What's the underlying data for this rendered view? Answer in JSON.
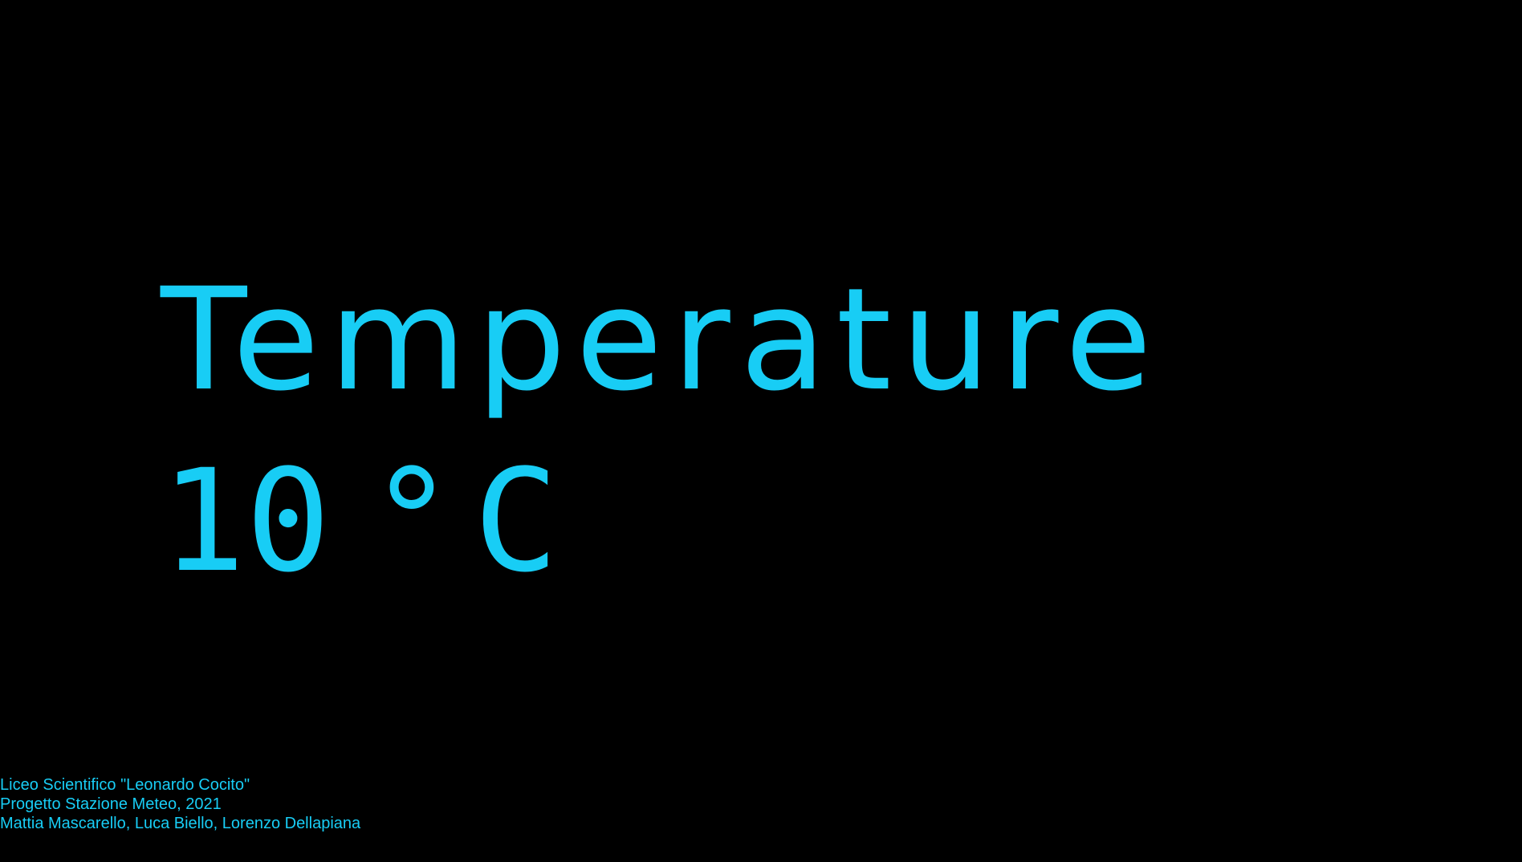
{
  "measurement": {
    "label": "Temperature",
    "value": "10",
    "unit": "°C"
  },
  "credits": {
    "school": "Liceo Scientifico \"Leonardo Cocito\"",
    "project": "Progetto Stazione Meteo, 2021",
    "authors": "Mattia Mascarello, Luca Biello, Lorenzo Dellapiana"
  },
  "colors": {
    "background": "#000000",
    "accent": "#18cdf5"
  }
}
